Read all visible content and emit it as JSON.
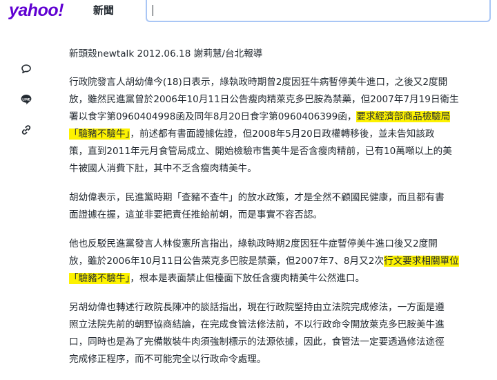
{
  "header": {
    "logo_text": "yahoo!",
    "section_label": "新聞",
    "search": {
      "value": "",
      "placeholder": ""
    }
  },
  "share": [
    {
      "name": "comment-button",
      "icon": "comment-icon"
    },
    {
      "name": "line-share-button",
      "icon": "line-icon",
      "label": "LINE"
    },
    {
      "name": "copy-link-button",
      "icon": "link-icon"
    }
  ],
  "article": {
    "byline": "新頭殼newtalk 2012.06.18 謝莉慧/台北報導",
    "paragraphs": [
      [
        [
          {
            "t": "行政院發言人胡幼偉今(18)日表示，綠執政時期曾2度因狂牛病暫停美牛進口，之後又2度開"
          }
        ],
        [
          {
            "t": "放，雖然民進黨曾於2006年10月11日公告瘦肉精萊克多巴胺為禁藥，但2007年7月19日衛生"
          }
        ],
        [
          {
            "t": "署以食字第0960404998函及同年8月20日食字第0960406399函，"
          },
          {
            "t": "要求經濟部商品檢驗局",
            "hl": true
          }
        ],
        [
          {
            "t": "「驗豬不驗牛」",
            "hl": true
          },
          {
            "t": "，前述都有書面證據佐證，但2008年5月20日政權轉移後，並未告知該政"
          }
        ],
        [
          {
            "t": "策，直到2011年元月食管局成立、開始檢驗市售美牛是否含瘦肉精前，已有10萬噸以上的美"
          }
        ],
        [
          {
            "t": "牛被國人消費下肚，其中不乏含瘦肉精美牛。"
          }
        ]
      ],
      [
        [
          {
            "t": "胡幼偉表示，民進黨時期「查豬不查牛」的放水政策，才是全然不顧國民健康，而且都有書"
          }
        ],
        [
          {
            "t": "面證據在握，這並非要把責任推給前朝，而是事實不容否認。"
          }
        ]
      ],
      [
        [
          {
            "t": "他也反駁民進黨發言人林俊憲所言指出，綠執政時期2度因狂牛症暫停美牛進口後又2度開"
          }
        ],
        [
          {
            "t": "放，雖於2006年10月11日公告萊克多巴胺是禁藥，但2007年7、8月又2次"
          },
          {
            "t": "行文要求相關單位",
            "hl": true
          }
        ],
        [
          {
            "t": "「驗豬不驗牛」",
            "hl": true
          },
          {
            "t": "，根本是表面禁止但檯面下放任含瘦肉精美牛公然進口。"
          }
        ]
      ],
      [
        [
          {
            "t": "另胡幼偉也轉述行政院長陳冲的談話指出，現在行政院堅持由立法院完成修法，一方面是遵"
          }
        ],
        [
          {
            "t": "照立法院先前的朝野協商結論，在完成食管法修法前，不以行政命令開放萊克多巴胺美牛進"
          }
        ],
        [
          {
            "t": "口，同時也是為了完備散裝牛肉須強制標示的法源依據，因此，食管法一定要透過修法途徑"
          }
        ],
        [
          {
            "t": "完成修正程序，而不可能完全以行政命令處理。"
          }
        ]
      ]
    ]
  },
  "colors": {
    "brand": "#6001d2",
    "highlight": "#fdf200",
    "text": "#232a31"
  }
}
